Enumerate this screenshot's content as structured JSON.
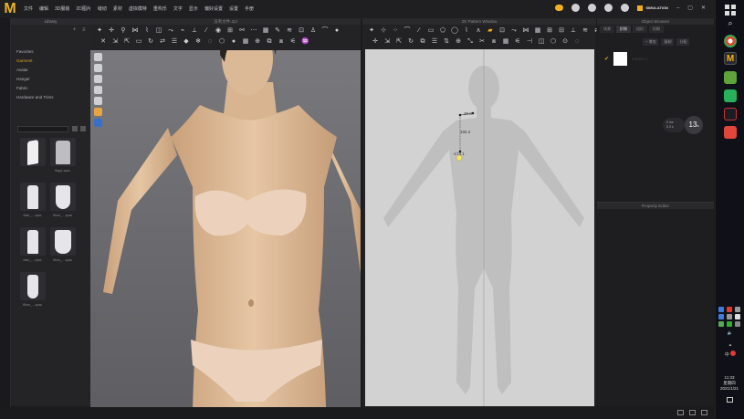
{
  "app": {
    "menus": [
      "文件",
      "编辑",
      "3D服装",
      "2D图片",
      "缝纫",
      "素材",
      "虚拟模特",
      "重构乐",
      "文字",
      "显示",
      "偏好设置",
      "设置",
      "手册"
    ],
    "mode": "SIMULATION"
  },
  "library": {
    "title": "Library",
    "categories": [
      "Favorites",
      "Garment",
      "Avatar",
      "Hanger",
      "Fabric",
      "Hardware and Trims"
    ],
    "selected": "Garment",
    "thumbnails": [
      {
        "label": "",
        "kind": "folder"
      },
      {
        "label": "Bag1.zpac",
        "kind": "bag"
      },
      {
        "label": "Man_....zpac",
        "kind": "suit"
      },
      {
        "label": "Wom_....zpac",
        "kind": "dress"
      },
      {
        "label": "Man_....zpac",
        "kind": "shirt"
      },
      {
        "label": "Wom_....zpac",
        "kind": "coat"
      },
      {
        "label": "Wom_....zpac",
        "kind": "gown"
      }
    ]
  },
  "view3d": {
    "title": "没有文件.Zpl"
  },
  "window2d": {
    "title": "2D Pattern Window",
    "measurements": {
      "top": "29.8",
      "mid": "165.2",
      "bottom": "-174.1"
    }
  },
  "object_browser": {
    "title": "Object Browser",
    "tabs": [
      "场景",
      "织物",
      "纽扣",
      "扣眼"
    ],
    "active_tab": "织物",
    "actions": [
      "+ 增加",
      "复制",
      "分配"
    ],
    "item_name": "FABRIC 1"
  },
  "sim_info": {
    "line1": "0 ms",
    "line2": "0.3 s",
    "fps": "13",
    "unit": "s"
  },
  "property_editor": {
    "title": "Property Editor"
  },
  "clock": {
    "time": "11:33",
    "weekday": "星期四",
    "date": "2021/1/21"
  },
  "tray": {
    "lang": "中"
  },
  "colors": {
    "accent": "#f2b11c",
    "skin": "#e0c2a0",
    "canvas": "#d2d2d2"
  }
}
